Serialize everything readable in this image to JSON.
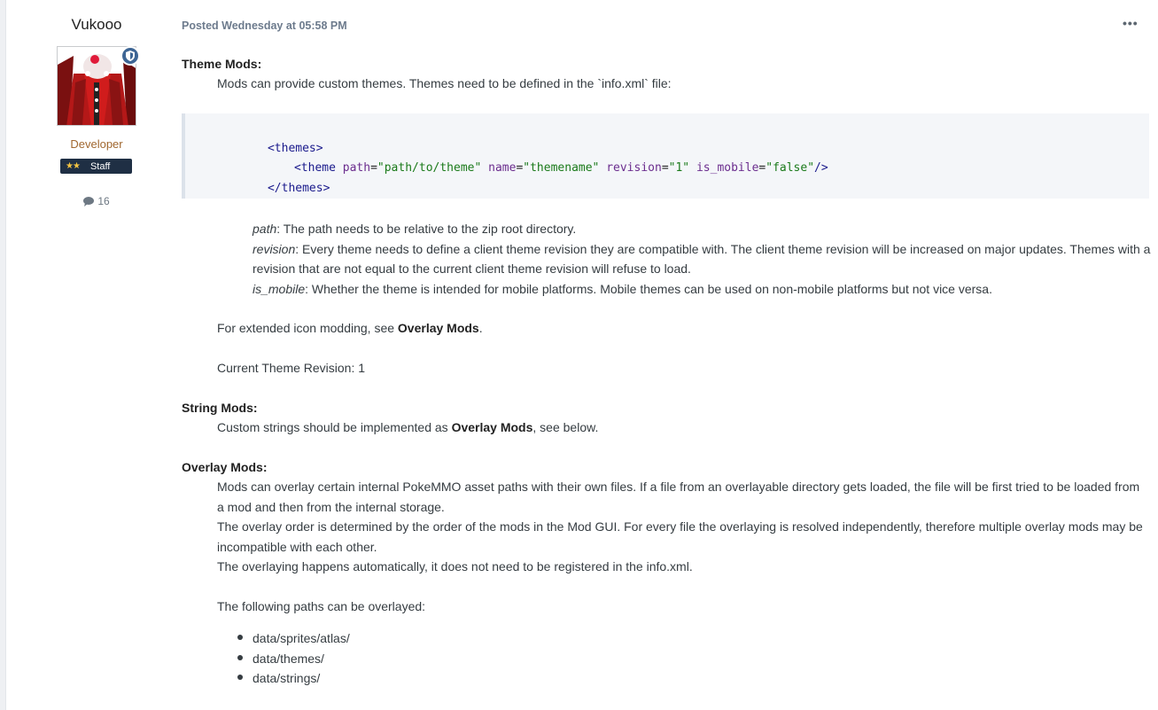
{
  "author": {
    "name": "Vukooo",
    "group": "Developer",
    "badge_stars": "★★",
    "badge_label": "Staff",
    "post_count": "16"
  },
  "post": {
    "meta": "Posted Wednesday at 05:58 PM",
    "more_icon": "•••",
    "theme_heading": "Theme Mods:",
    "theme_intro": "Mods can provide custom themes. Themes need to be defined in the `info.xml` file:",
    "code": {
      "line1_open": "<themes>",
      "line2_tag_open": "<theme",
      "line2_attr1": "path",
      "line2_val1": "\"path/to/theme\"",
      "line2_attr2": "name",
      "line2_val2": "\"themename\"",
      "line2_attr3": "revision",
      "line2_val3": "\"1\"",
      "line2_attr4": "is_mobile",
      "line2_val4": "\"false\"",
      "line2_close": "/>",
      "line3_close": "</themes>"
    },
    "defs": [
      {
        "term": "path",
        "text": ": The path needs to be relative to the zip root directory."
      },
      {
        "term": "revision",
        "text": ": Every theme needs to define a client theme revision they are compatible with. The client theme revision will be increased on major updates. Themes with a"
      },
      {
        "term": "",
        "text": "revision that are not equal to the current client theme revision will refuse to load."
      },
      {
        "term": "is_mobile",
        "text": ": Whether the theme is intended for mobile platforms. Mobile themes can be used on non-mobile platforms but not vice versa."
      }
    ],
    "icon_modding_pre": "For extended icon modding, see ",
    "icon_modding_link": "Overlay Mods",
    "icon_modding_post": ".",
    "current_revision": "Current Theme Revision: 1",
    "string_heading": "String Mods:",
    "string_pre": "Custom strings should be implemented as ",
    "string_link": "Overlay Mods",
    "string_post": ", see below.",
    "overlay_heading": "Overlay Mods:",
    "overlay_lines": [
      "Mods can overlay certain internal PokeMMO asset paths with their own files. If a file from an overlayable directory gets loaded, the file will be first tried to be loaded from",
      "a mod and then from the internal storage.",
      "The overlay order is determined by the order of the mods in the Mod GUI. For every file the overlaying is resolved independently, therefore multiple overlay mods may be",
      "incompatible with each other.",
      "The overlaying happens automatically, it does not need to be registered in the info.xml."
    ],
    "overlay_list_intro": "The following paths can be overlayed:",
    "overlay_paths": [
      "data/sprites/atlas/",
      "data/themes/",
      "data/strings/"
    ]
  },
  "colors": {
    "accent_badge": "#3d6594",
    "group_title": "#a0672f",
    "staff_badge_bg": "#1f2f44"
  }
}
